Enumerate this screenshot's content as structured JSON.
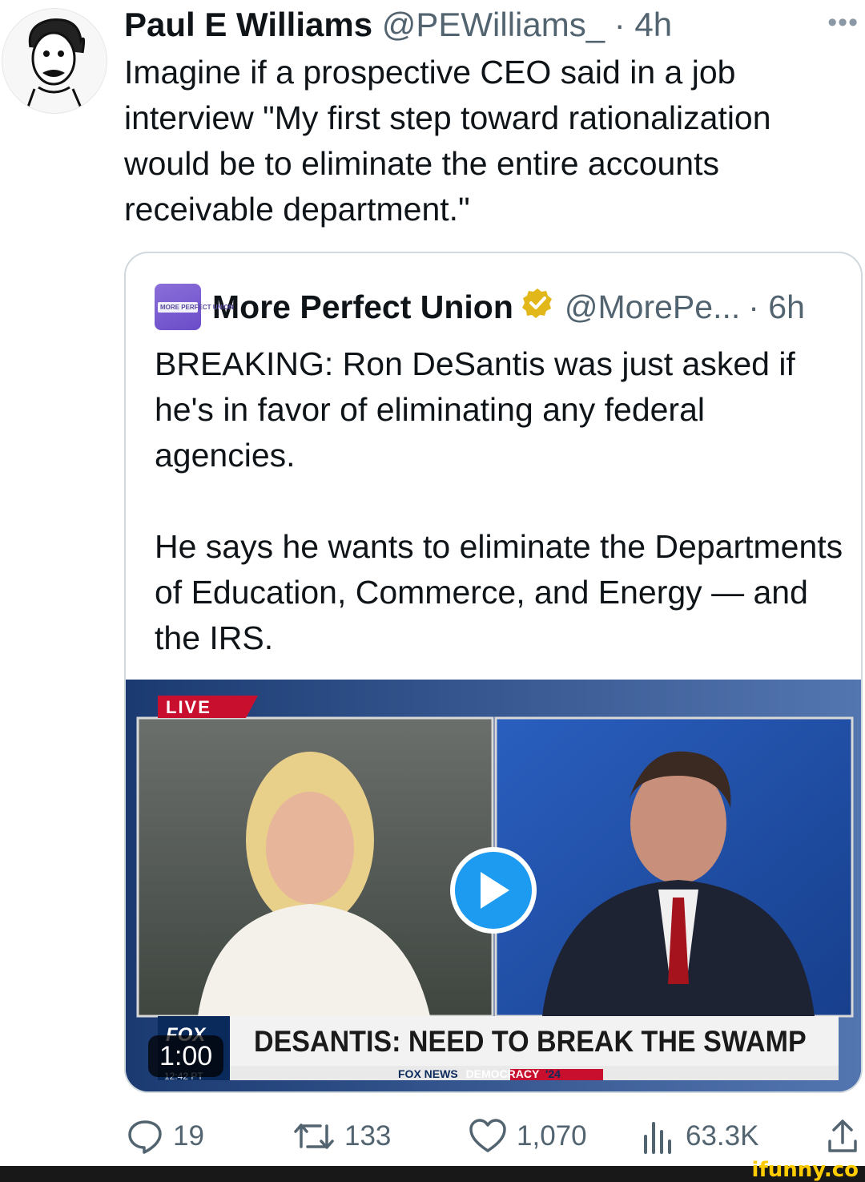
{
  "tweet": {
    "author_name": "Paul E Williams",
    "author_handle": "@PEWilliams_",
    "time": "· 4h",
    "text": "Imagine if a prospective CEO said in a job interview \"My first step toward rationalization would be to eliminate the entire accounts receivable department.\"",
    "more_icon": "more-horizontal-icon"
  },
  "quote": {
    "logo_text": "MORE PERFECT UNION",
    "name": "More Perfect Union",
    "handle": "@MorePe...",
    "time": "· 6h",
    "text": "BREAKING: Ron DeSantis was just asked if he's in favor of eliminating any federal agencies.\n\nHe says he wants to eliminate the Departments of Education, Commerce, and Energy — and the IRS.",
    "verified_color": "#e2b719"
  },
  "video": {
    "live_label": "LIVE",
    "headline": "DESANTIS: NEED TO BREAK THE SWAMP",
    "network": "FOX NEWS",
    "segment": "DEMOCRACY",
    "segment_year": "'24",
    "clock": "12:42 PT",
    "duration": "1:00",
    "fox_logo": "FOX"
  },
  "actions": {
    "replies": "19",
    "reposts": "133",
    "likes": "1,070",
    "views": "63.3K"
  },
  "watermark": "ifunny.co",
  "colors": {
    "accent": "#1d9bf0",
    "muted": "#536471",
    "border": "#cfd9de"
  }
}
